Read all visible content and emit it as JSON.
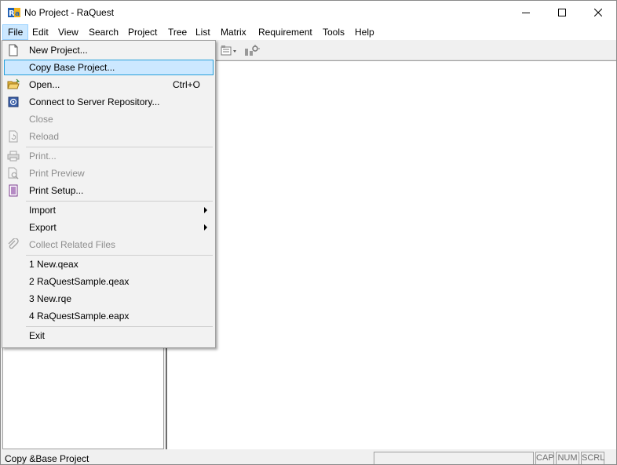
{
  "window": {
    "title": "No Project - RaQuest",
    "app_icon": "raquest-logo-icon"
  },
  "menubar": {
    "items": [
      "File",
      "Edit",
      "View",
      "Search",
      "Project",
      "Tree",
      "List",
      "Matrix",
      "Requirement",
      "Tools",
      "Help"
    ]
  },
  "file_menu": {
    "items": [
      {
        "label": "New Project...",
        "icon": "new-document-icon",
        "enabled": true
      },
      {
        "label": "Copy Base Project...",
        "icon": "",
        "enabled": true,
        "highlighted": true
      },
      {
        "label": "Open...",
        "shortcut": "Ctrl+O",
        "icon": "open-folder-icon",
        "enabled": true
      },
      {
        "label": "Connect to Server Repository...",
        "icon": "server-repository-icon",
        "enabled": true
      },
      {
        "label": "Close",
        "icon": "",
        "enabled": false
      },
      {
        "label": "Reload",
        "icon": "reload-icon",
        "enabled": false
      },
      {
        "label": "Print...",
        "icon": "printer-icon",
        "enabled": false
      },
      {
        "label": "Print Preview",
        "icon": "print-preview-icon",
        "enabled": false
      },
      {
        "label": "Print Setup...",
        "icon": "print-setup-icon",
        "enabled": true
      },
      {
        "label": "Import",
        "icon": "",
        "enabled": true,
        "submenu": true
      },
      {
        "label": "Export",
        "icon": "",
        "enabled": true,
        "submenu": true
      },
      {
        "label": "Collect Related Files",
        "icon": "paperclip-icon",
        "enabled": false
      },
      {
        "label": "1 New.qeax",
        "enabled": true
      },
      {
        "label": "2 RaQuestSample.qeax",
        "enabled": true
      },
      {
        "label": "3 New.rqe",
        "enabled": true
      },
      {
        "label": "4 RaQuestSample.eapx",
        "enabled": true
      },
      {
        "label": "Exit",
        "enabled": true
      }
    ]
  },
  "statusbar": {
    "message": "Copy &Base Project",
    "indicators": [
      "CAP",
      "NUM",
      "SCRL"
    ]
  },
  "colors": {
    "highlight_bg": "#cce8ff",
    "highlight_border": "#26a0da",
    "disabled_text": "#8d8d8d"
  }
}
